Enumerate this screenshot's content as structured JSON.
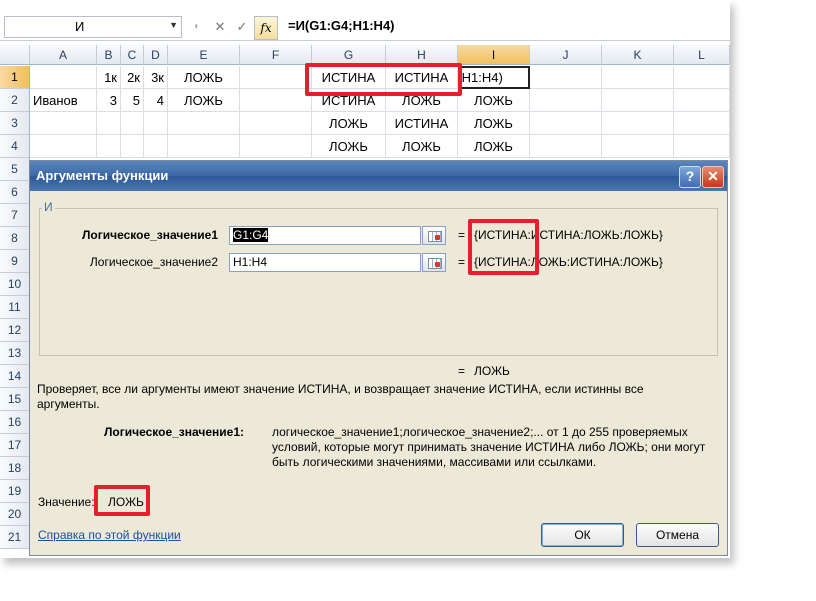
{
  "formula_bar": {
    "name_box": "И",
    "cancel_icon": "✕",
    "enter_icon": "✓",
    "fx_label": "fx",
    "formula": "=И(G1:G4;H1:H4)"
  },
  "columns": [
    "A",
    "B",
    "C",
    "D",
    "E",
    "F",
    "G",
    "H",
    "I",
    "J",
    "K",
    "L"
  ],
  "rows": [
    "1",
    "2",
    "3",
    "4",
    "5",
    "6",
    "7",
    "8",
    "9",
    "10",
    "11",
    "12",
    "13",
    "14",
    "15",
    "16",
    "17",
    "18",
    "19",
    "20",
    "21"
  ],
  "cells": {
    "r1": [
      "",
      "1к",
      "2к",
      "3к",
      "ЛОЖЬ",
      "",
      "ИСТИНА",
      "ИСТИНА",
      ";H1:H4)"
    ],
    "r2": [
      "Иванов",
      "3",
      "5",
      "4",
      "ЛОЖЬ",
      "",
      "ИСТИНА",
      "ЛОЖЬ",
      "ЛОЖЬ"
    ],
    "r3": [
      "",
      "",
      "",
      "",
      "",
      "",
      "ЛОЖЬ",
      "ИСТИНА",
      "ЛОЖЬ"
    ],
    "r4": [
      "",
      "",
      "",
      "",
      "",
      "",
      "ЛОЖЬ",
      "ЛОЖЬ",
      "ЛОЖЬ"
    ]
  },
  "dialog": {
    "title": "Аргументы функции",
    "help": "?",
    "close": "✕",
    "function_name": "И",
    "arg1_label": "Логическое_значение1",
    "arg1_value": "G1:G4",
    "arg1_result": "{ИСТИНА:ИСТИНА:ЛОЖЬ:ЛОЖЬ}",
    "arg2_label": "Логическое_значение2",
    "arg2_value": "H1:H4",
    "arg2_result": "{ИСТИНА:ЛОЖЬ:ИСТИНА:ЛОЖЬ}",
    "eq": "=",
    "formula_result": "ЛОЖЬ",
    "description": "Проверяет, все ли аргументы имеют значение ИСТИНА, и возвращает значение ИСТИНА, если истинны все аргументы.",
    "arg_help_label": "Логическое_значение1:",
    "arg_help_text": "логическое_значение1;логическое_значение2;... от 1 до 255 проверяемых условий, которые могут принимать значение ИСТИНА либо ЛОЖЬ; они могут быть логическими значениями, массивами или ссылками.",
    "value_label": "Значение:",
    "value": "ЛОЖЬ",
    "help_link": "Справка по этой функции",
    "ok": "ОК",
    "cancel": "Отмена"
  }
}
